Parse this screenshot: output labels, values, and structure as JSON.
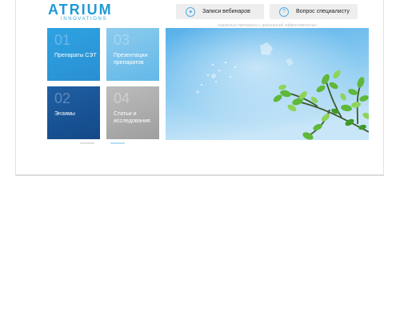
{
  "brand": {
    "name": "ATRIUM",
    "subtitle": "INNOVATIONS",
    "color": "#1f9ad6"
  },
  "header": {
    "webinars_label": "Записи вебинаров",
    "question_label": "Вопрос специалисту",
    "webinars_icon": "play-icon",
    "question_icon": "question-icon",
    "tagline": "надежные препараты с доказанной эффективностью"
  },
  "tiles": [
    {
      "num": "01",
      "label": "Препараты СЭТ",
      "color": "#2ea3e2"
    },
    {
      "num": "03",
      "label": "Презентации препаратов",
      "color": "#7cc3ec"
    },
    {
      "num": "02",
      "label": "Энзимы",
      "color": "#1a569a"
    },
    {
      "num": "04",
      "label": "Статьи и исследования",
      "color": "#adadad"
    }
  ],
  "hero": {
    "image": "tree-branch-sky"
  }
}
